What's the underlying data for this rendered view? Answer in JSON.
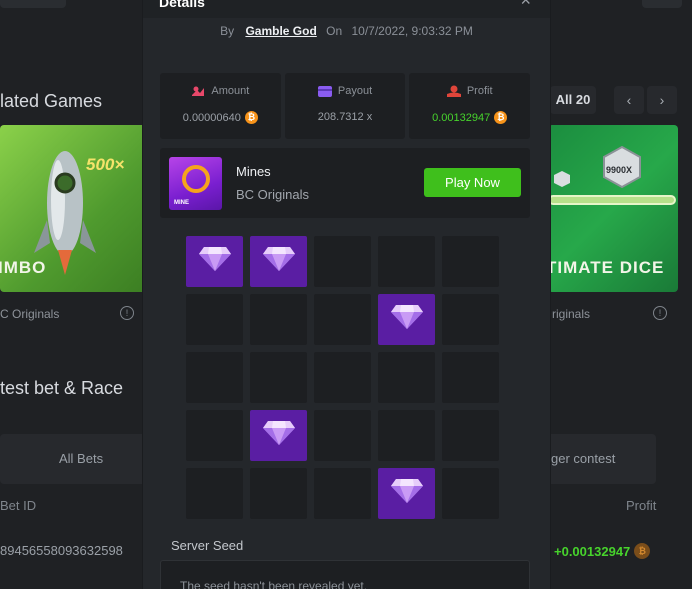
{
  "background": {
    "related_games_title": "lated Games",
    "latest_bet_title": "test bet & Race",
    "left_card": {
      "text": "IMBO",
      "multiplier": "500×",
      "provider": "C Originals"
    },
    "right_card": {
      "text": "TIMATE DICE",
      "multiplier": "9900X",
      "provider": "riginals"
    },
    "nav": {
      "all_label": "All 20",
      "prev_icon": "chevron-left-icon",
      "next_icon": "chevron-right-icon"
    },
    "tabs": {
      "all_bets": "All Bets",
      "contest": "ger contest"
    },
    "table": {
      "columns": {
        "bet_id": "Bet ID",
        "profit": "Profit"
      },
      "row": {
        "bet_id": "89456558093632598",
        "profit": "+0.00132947"
      }
    }
  },
  "modal": {
    "title": "Details",
    "close_icon": "close-icon",
    "byline": {
      "by_label": "By",
      "user": "Gamble God",
      "on_label": "On",
      "datetime": "10/7/2022, 9:03:32 PM"
    },
    "stats": {
      "amount": {
        "label": "Amount",
        "value": "0.00000640",
        "icon": "coins-icon"
      },
      "payout": {
        "label": "Payout",
        "value": "208.7312 x",
        "icon": "card-icon"
      },
      "profit": {
        "label": "Profit",
        "value": "0.00132947",
        "icon": "hand-coin-icon"
      }
    },
    "game": {
      "name": "Mines",
      "provider": "BC Originals",
      "thumb_tag": "MINE",
      "play_label": "Play Now"
    },
    "grid": {
      "cols": 5,
      "rows": 5,
      "cells": [
        "gem",
        "gem",
        "empty",
        "empty",
        "empty",
        "empty",
        "empty",
        "empty",
        "gem",
        "empty",
        "empty",
        "empty",
        "empty",
        "empty",
        "empty",
        "empty",
        "gem",
        "empty",
        "empty",
        "empty",
        "empty",
        "empty",
        "empty",
        "gem",
        "empty"
      ]
    },
    "seed": {
      "label": "Server Seed",
      "text": "The seed hasn't been revealed yet."
    }
  },
  "colors": {
    "accent_green": "#3fbf1c",
    "profit_green": "#47d32c",
    "gem_cell": "#5a1ea3",
    "btc_orange": "#f7931a"
  }
}
